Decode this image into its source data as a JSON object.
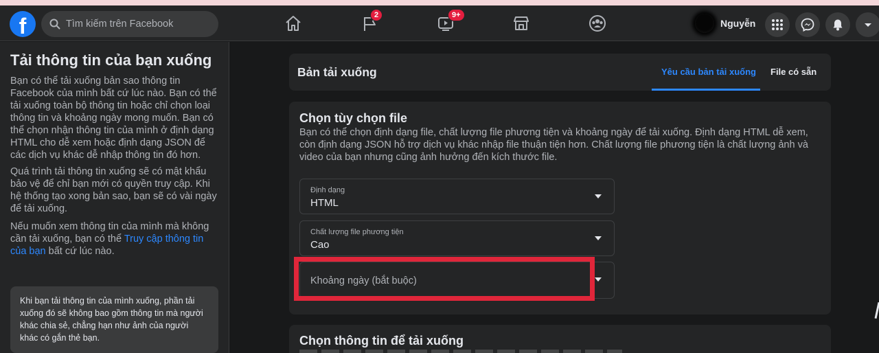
{
  "topbar": {
    "search_placeholder": "Tìm kiếm trên Facebook",
    "badges": {
      "pages": "2",
      "watch": "9+"
    },
    "profile_name": "Nguyễn"
  },
  "sidebar": {
    "title": "Tải thông tin của bạn xuống",
    "paragraph1": "Bạn có thể tải xuống bản sao thông tin Facebook của mình bất cứ lúc nào. Bạn có thể tải xuống toàn bộ thông tin hoặc chỉ chọn loại thông tin và khoảng ngày mong muốn. Bạn có thể chọn nhận thông tin của mình ở định dạng HTML cho dễ xem hoặc định dạng JSON để các dịch vụ khác dễ nhập thông tin đó hơn.",
    "paragraph2": "Quá trình tải thông tin xuống sẽ có mật khẩu bảo vệ để chỉ bạn mới có quyền truy cập. Khi hệ thống tạo xong bản sao, bạn sẽ có vài ngày để tải xuống.",
    "paragraph3_before": "Nếu muốn xem thông tin của mình mà không cần tải xuống, bạn có thể ",
    "paragraph3_link": "Truy cập thông tin của bạn",
    "paragraph3_after": " bất cứ lúc nào.",
    "note": "Khi bạn tải thông tin của mình xuống, phần tải xuống đó sẽ không bao gồm thông tin mà người khác chia sẻ, chẳng hạn như ảnh của người khác có gắn thẻ bạn."
  },
  "header": {
    "title": "Bản tải xuống",
    "tab_request": "Yêu cầu bản tải xuống",
    "tab_available": "File có sẵn"
  },
  "file_options": {
    "title": "Chọn tùy chọn file",
    "description": "Bạn có thể chọn định dạng file, chất lượng file phương tiện và khoảng ngày để tải xuống. Định dạng HTML dễ xem, còn định dạng JSON hỗ trợ dịch vụ khác nhập file thuận tiện hơn. Chất lượng file phương tiện là chất lượng ảnh và video của bạn nhưng cũng ảnh hưởng đến kích thước file.",
    "format": {
      "label": "Định dạng",
      "value": "HTML"
    },
    "quality": {
      "label": "Chất lượng file phương tiện",
      "value": "Cao"
    },
    "date_range": {
      "placeholder": "Khoảng ngày (bắt buộc)"
    }
  },
  "choose_info": {
    "title": "Chọn thông tin để tải xuống"
  },
  "colors": {
    "accent": "#2d88ff",
    "badge": "#e41e3f",
    "highlight": "#e0263a"
  },
  "icons": [
    "search-icon",
    "home-icon",
    "pages-flag-icon",
    "watch-icon",
    "marketplace-icon",
    "groups-icon",
    "menu-grid-icon",
    "messenger-icon",
    "notifications-bell-icon",
    "account-caret-icon"
  ]
}
